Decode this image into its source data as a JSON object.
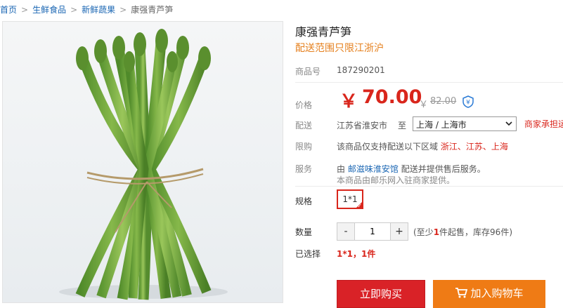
{
  "breadcrumb": {
    "home": "首页",
    "c1": "生鲜食品",
    "c2": "新鲜蔬果",
    "current": "康强青芦笋",
    "sep": ">"
  },
  "product": {
    "title": "康强青芦笋",
    "subtitle": "配送范围只限江浙沪",
    "sku_label": "商品号",
    "sku": "187290201",
    "price_label": "价格",
    "currency": "￥",
    "price": "70.00",
    "orig_price": "82.00",
    "shipping_label": "配送",
    "from": "江苏省淮安市",
    "to_word": "至",
    "destination": "上海 / 上海市",
    "seller_note": "商家承担运",
    "limit_label": "限购",
    "limit_text": "该商品仅支持配送以下区域",
    "limit_regions": "浙江、江苏、上海",
    "service_label": "服务",
    "service_prefix": "由",
    "service_store": "邮滋味淮安馆",
    "service_suffix": "配送并提供售后服务。",
    "service_line2": "本商品由邮乐网入驻商家提供。",
    "spec_label": "规格",
    "spec_value": "1*1",
    "qty_label": "数量",
    "qty_minus": "-",
    "qty_value": "1",
    "qty_plus": "+",
    "stock_prefix": "(至少",
    "stock_min": "1",
    "stock_mid": "件起售，库存96件)",
    "chosen_label": "已选择",
    "chosen_value": "1*1，1件",
    "buy_label": "立即购买",
    "cart_label": "加入购物车"
  },
  "colors": {
    "accent": "#d9261c",
    "link": "#1a66b3",
    "cart": "#ef7b15",
    "subtitle": "#e5801e"
  }
}
